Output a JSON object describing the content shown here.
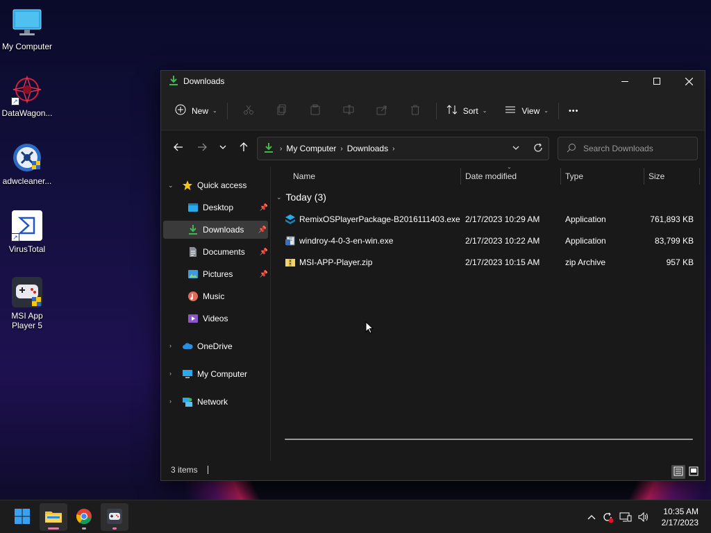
{
  "desktop": {
    "icons": [
      {
        "label": "My Computer"
      },
      {
        "label": "DataWagon..."
      },
      {
        "label": "adwcleaner..."
      },
      {
        "label": "VirusTotal"
      },
      {
        "label": "MSI App Player 5"
      }
    ]
  },
  "window": {
    "title": "Downloads",
    "controls": {
      "minimize": "—",
      "maximize": "☐",
      "close": "✕"
    }
  },
  "toolbar": {
    "new_label": "New",
    "sort_label": "Sort",
    "view_label": "View",
    "more_label": "•••"
  },
  "address": {
    "crumbs": [
      "My Computer",
      "Downloads"
    ]
  },
  "search": {
    "placeholder": "Search Downloads"
  },
  "nav": {
    "quick_access": "Quick access",
    "items": [
      {
        "label": "Desktop",
        "pinned": true
      },
      {
        "label": "Downloads",
        "pinned": true,
        "selected": true
      },
      {
        "label": "Documents",
        "pinned": true
      },
      {
        "label": "Pictures",
        "pinned": true
      },
      {
        "label": "Music",
        "pinned": false
      },
      {
        "label": "Videos",
        "pinned": false
      }
    ],
    "roots": [
      {
        "label": "OneDrive"
      },
      {
        "label": "My Computer"
      },
      {
        "label": "Network"
      }
    ]
  },
  "columns": {
    "name": "Name",
    "date": "Date modified",
    "type": "Type",
    "size": "Size"
  },
  "group": {
    "label": "Today (3)"
  },
  "files": [
    {
      "name": "RemixOSPlayerPackage-B2016111403.exe",
      "date": "2/17/2023 10:29 AM",
      "type": "Application",
      "size": "761,893 KB"
    },
    {
      "name": "windroy-4-0-3-en-win.exe",
      "date": "2/17/2023 10:22 AM",
      "type": "Application",
      "size": "83,799 KB"
    },
    {
      "name": "MSI-APP-Player.zip",
      "date": "2/17/2023 10:15 AM",
      "type": "zip Archive",
      "size": "957 KB"
    }
  ],
  "status": {
    "count": "3 items"
  },
  "taskbar": {
    "time": "10:35 AM",
    "date": "2/17/2023"
  },
  "colors": {
    "accent": "#0078d4",
    "folder_green": "#3fb950",
    "window_bg": "#191919"
  }
}
